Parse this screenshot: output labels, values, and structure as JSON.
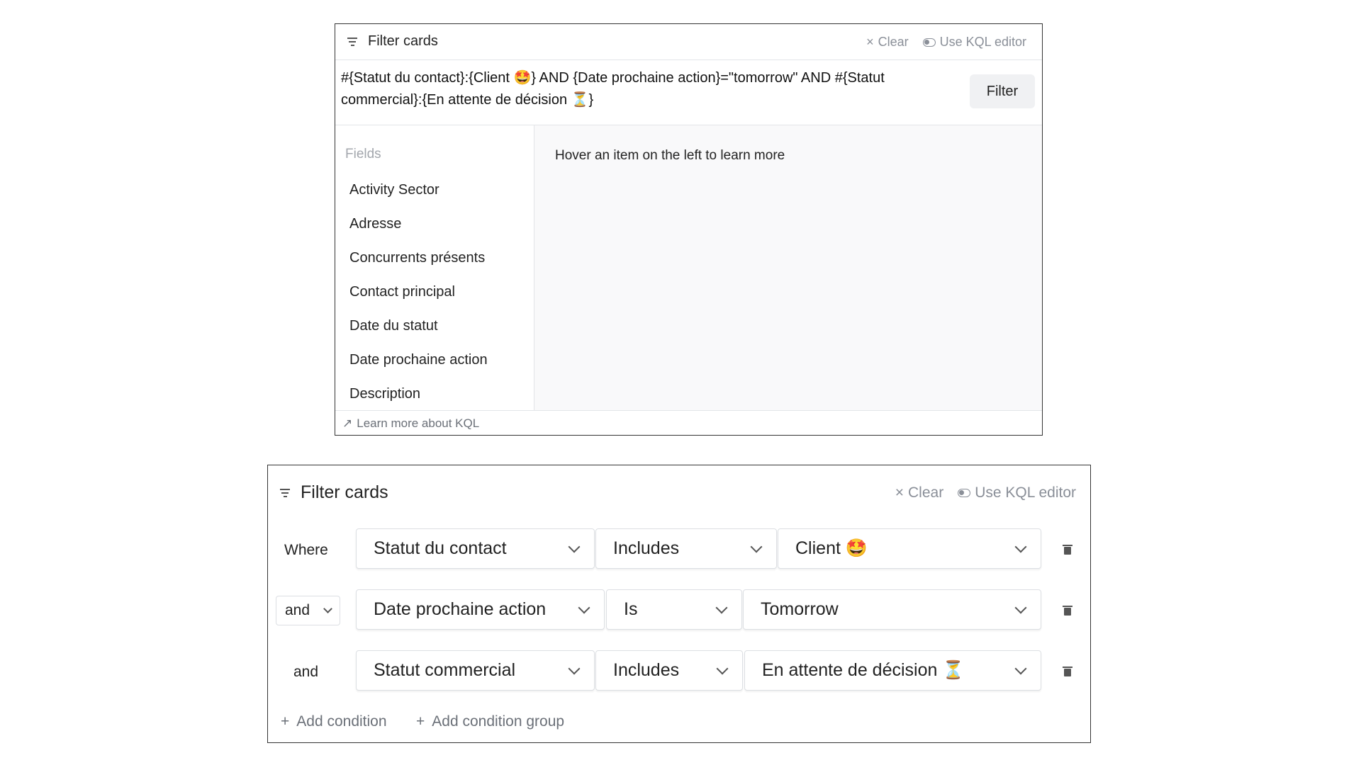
{
  "kql_panel": {
    "title": "Filter cards",
    "clear_label": "Clear",
    "kql_toggle_label": "Use KQL editor",
    "query": "#{Statut du contact}:{Client 🤩} AND {Date prochaine action}=\"tomorrow\" AND #{Statut commercial}:{En attente de décision ⏳}",
    "filter_button": "Filter",
    "fields_heading": "Fields",
    "fields": [
      "Activity Sector",
      "Adresse",
      "Concurrents présents",
      "Contact principal",
      "Date du statut",
      "Date prochaine action",
      "Description"
    ],
    "hint": "Hover an item on the left to learn more",
    "learn_more": "Learn more about KQL"
  },
  "builder_panel": {
    "title": "Filter cards",
    "clear_label": "Clear",
    "kql_toggle_label": "Use KQL editor",
    "conditions": [
      {
        "connector": "Where",
        "field": "Statut du contact",
        "operator": "Includes",
        "value": "Client 🤩"
      },
      {
        "connector": "and",
        "field": "Date prochaine action",
        "operator": "Is",
        "value": "Tomorrow"
      },
      {
        "connector": "and",
        "field": "Statut commercial",
        "operator": "Includes",
        "value": "En attente de décision ⏳"
      }
    ],
    "add_condition": "Add condition",
    "add_condition_group": "Add condition group"
  }
}
